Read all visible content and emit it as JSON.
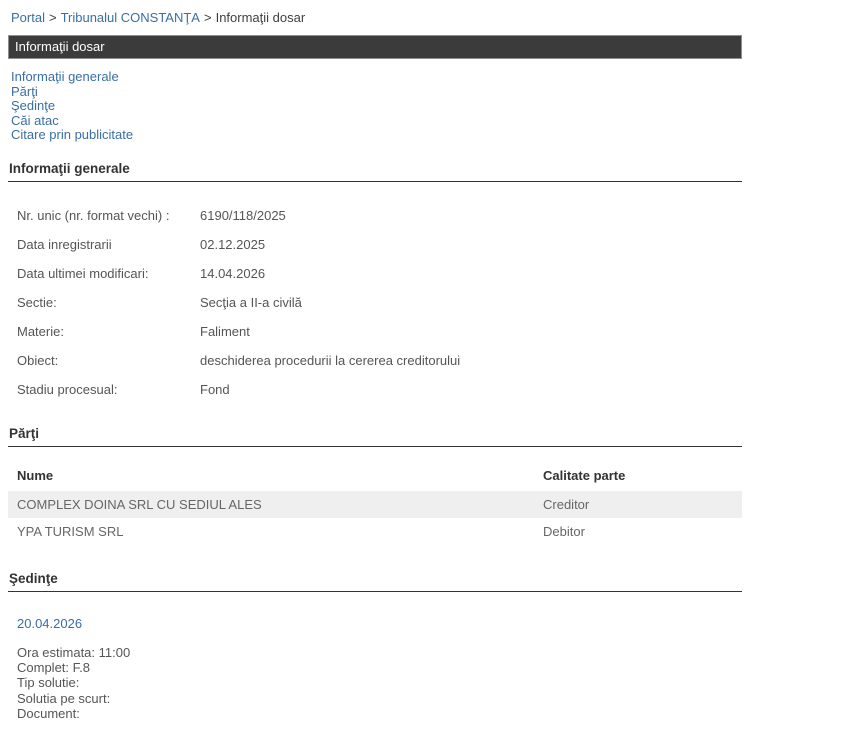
{
  "colors": {
    "link_blue": "#3A6EA5",
    "title_bar_bg": "#3B3B3B",
    "title_bar_text": "#FFFFFF",
    "alt_row_bg": "#EFEFEF",
    "section_rule": "#333333"
  },
  "breadcrumb": {
    "separator": ">",
    "items": [
      {
        "label": "Portal"
      },
      {
        "label": "Tribunalul CONSTANŢA"
      },
      {
        "label": "Informaţii dosar"
      }
    ]
  },
  "title_bar": {
    "label": "Informaţii dosar"
  },
  "nav": {
    "links": [
      {
        "label": "Informaţii generale"
      },
      {
        "label": "Părţi"
      },
      {
        "label": "Şedinţe"
      },
      {
        "label": "Căi atac"
      },
      {
        "label": "Citare prin publicitate"
      }
    ]
  },
  "general": {
    "title": "Informaţii generale",
    "fields": [
      {
        "label": "Nr. unic (nr. format vechi) :",
        "value": "6190/118/2025"
      },
      {
        "label": "Data inregistrarii",
        "value": "02.12.2025"
      },
      {
        "label": "Data ultimei modificari:",
        "value": "14.04.2026"
      },
      {
        "label": "Sectie:",
        "value": "Secţia a II-a civilă"
      },
      {
        "label": "Materie:",
        "value": "Faliment"
      },
      {
        "label": "Obiect:",
        "value": "deschiderea procedurii la cererea creditorului"
      },
      {
        "label": "Stadiu procesual:",
        "value": "Fond"
      }
    ]
  },
  "parties": {
    "title": "Părţi",
    "headers": [
      "Nume",
      "Calitate parte"
    ],
    "rows": [
      {
        "name": "COMPLEX DOINA SRL CU SEDIUL ALES",
        "role": "Creditor"
      },
      {
        "name": "YPA TURISM SRL",
        "role": "Debitor"
      }
    ]
  },
  "hearings": {
    "title": "Şedinţe",
    "items": [
      {
        "date": "20.04.2026",
        "details": [
          "Ora estimata: 11:00",
          "Complet: F.8",
          "Tip solutie:",
          "Solutia pe scurt:",
          "Document:"
        ]
      }
    ]
  }
}
